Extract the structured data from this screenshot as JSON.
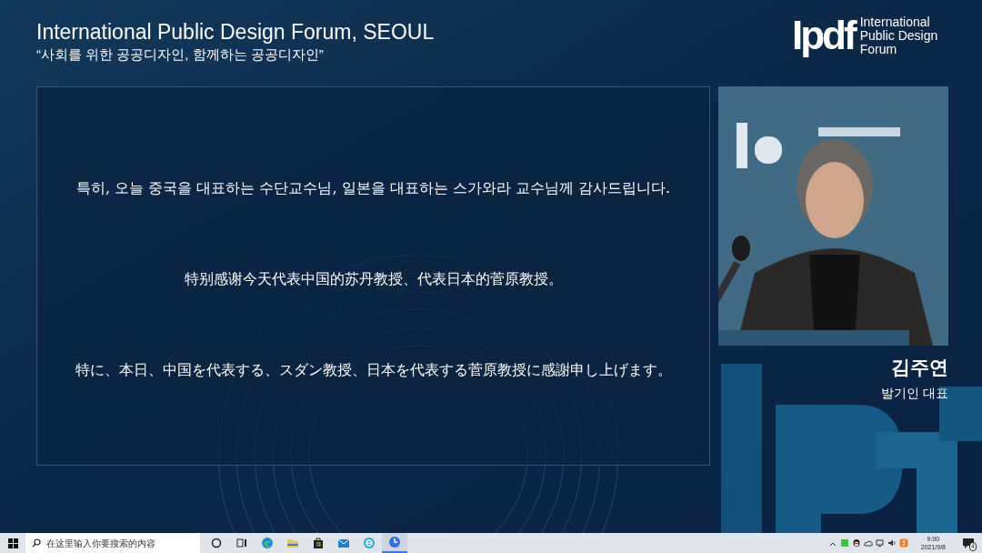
{
  "header": {
    "title": "International Public Design Forum, SEOUL",
    "subtitle": "“사회를 위한 공공디자인, 함께하는 공공디자인”"
  },
  "logo": {
    "mark": "Ipdf",
    "lines": [
      "International",
      "Public Design",
      "Forum"
    ]
  },
  "slide": {
    "lines": [
      "특히, 오늘 중국을 대표하는 수단교수님, 일본을 대표하는 스가와라 교수님께 감사드립니다.",
      "特别感谢今天代表中国的苏丹教授、代表日本的菅原教授。",
      "特に、本日、中国を代表する、スダン教授、日本を代表する菅原教授に感謝申し上げます。"
    ]
  },
  "speaker": {
    "name": "김주연",
    "role": "발기인 대표"
  },
  "taskbar": {
    "search": {
      "placeholder": "在这里输入你要搜索的内容"
    },
    "apps": [
      {
        "kind": "cortana",
        "selected": false
      },
      {
        "kind": "taskview",
        "selected": false
      },
      {
        "kind": "edge",
        "selected": false
      },
      {
        "kind": "folder",
        "selected": false
      },
      {
        "kind": "store",
        "selected": false
      },
      {
        "kind": "mail",
        "selected": false
      },
      {
        "kind": "ie",
        "selected": false
      },
      {
        "kind": "clockapp",
        "selected": true
      }
    ],
    "tray": [
      {
        "kind": "chevron"
      },
      {
        "kind": "green"
      },
      {
        "kind": "penguin"
      },
      {
        "kind": "cloud"
      },
      {
        "kind": "network"
      },
      {
        "kind": "volume"
      },
      {
        "kind": "ime"
      }
    ],
    "clock": {
      "time": "9:00",
      "date": "2021/9/8"
    },
    "notifications": "4"
  }
}
